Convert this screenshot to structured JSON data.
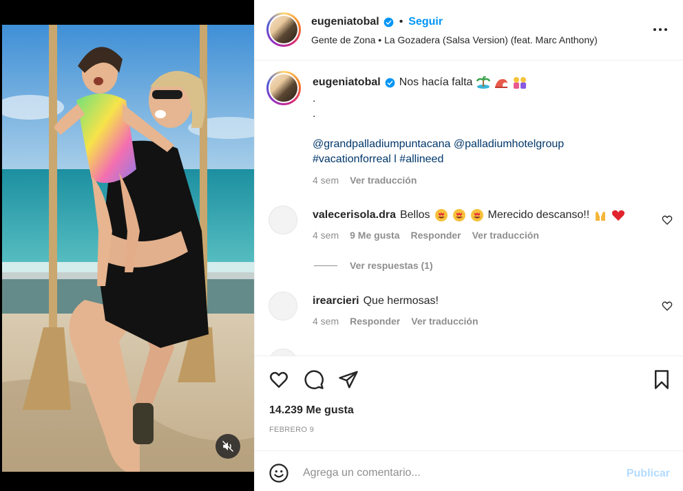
{
  "post": {
    "username": "eugeniatobal",
    "follow_label": "Seguir",
    "separator": "•",
    "audio": "Gente de Zona • La Gozadera (Salsa Version) (feat. Marc Anthony)"
  },
  "caption": {
    "username": "eugeniatobal",
    "text": "Nos hacía falta",
    "emojis": [
      "palm-island-emoji",
      "wave-emoji",
      "family-emoji"
    ],
    "dot1": ".",
    "dot2": ".",
    "mentions": "@grandpalladiumpuntacana @palladiumhotelgroup",
    "hashtags": "#vacationforreal l #allineed",
    "time": "4 sem",
    "translate": "Ver traducción"
  },
  "comments": [
    {
      "username": "valecerisola.dra",
      "text_before": "Bellos",
      "text_after": "Merecido descanso!!",
      "time": "4 sem",
      "likes": "9 Me gusta",
      "reply": "Responder",
      "translate": "Ver traducción",
      "view_replies": "Ver respuestas (1)"
    },
    {
      "username": "irearcieri",
      "text": "Que hermosas!",
      "time": "4 sem",
      "reply": "Responder",
      "translate": "Ver traducción"
    }
  ],
  "stats": {
    "likes": "14.239 Me gusta",
    "date": "FEBRERO 9"
  },
  "composer": {
    "placeholder": "Agrega un comentario...",
    "publish": "Publicar"
  },
  "colors": {
    "accent": "#0095f6",
    "link": "#00376b",
    "muted": "#8e8e8e",
    "publish_disabled": "#b3dbff"
  },
  "icons": [
    "verified-badge-icon",
    "more-options-icon",
    "heart-icon",
    "comment-icon",
    "share-icon",
    "bookmark-icon",
    "emoji-icon",
    "mute-icon"
  ]
}
